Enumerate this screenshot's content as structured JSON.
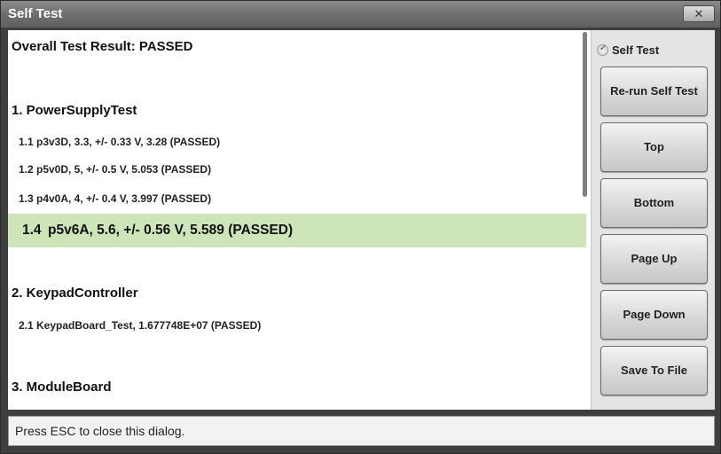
{
  "window": {
    "title": "Self Test",
    "close_glyph": "✕"
  },
  "results": {
    "overall": "Overall Test Result: PASSED",
    "sections": [
      {
        "heading": "1. PowerSupplyTest",
        "items": [
          {
            "num": "1.1",
            "text": "p3v3D, 3.3, +/- 0.33 V, 3.28 (PASSED)"
          },
          {
            "num": "1.2",
            "text": "p5v0D, 5, +/- 0.5 V, 5.053 (PASSED)"
          },
          {
            "num": "1.3",
            "text": "p4v0A, 4, +/- 0.4 V, 3.997 (PASSED)"
          },
          {
            "num": "1.4",
            "text": "p5v6A, 5.6, +/- 0.56 V, 5.589 (PASSED)",
            "selected": true
          }
        ]
      },
      {
        "heading": "2. KeypadController",
        "items": [
          {
            "num": "2.1",
            "text": "KeypadBoard_Test, 1.677748E+07 (PASSED)"
          }
        ]
      },
      {
        "heading": "3. ModuleBoard",
        "items": []
      }
    ]
  },
  "sidepanel": {
    "radio_label": "Self Test",
    "buttons": {
      "rerun": "Re-run Self Test",
      "top": "Top",
      "bottom": "Bottom",
      "page_up": "Page Up",
      "page_down": "Page Down",
      "save": "Save To File"
    }
  },
  "status": {
    "text": "Press ESC to close this dialog."
  },
  "colors": {
    "selected_row": "#cde5b8",
    "title_bar": "#6e6e6e",
    "panel_bg": "#e4e4e4"
  }
}
